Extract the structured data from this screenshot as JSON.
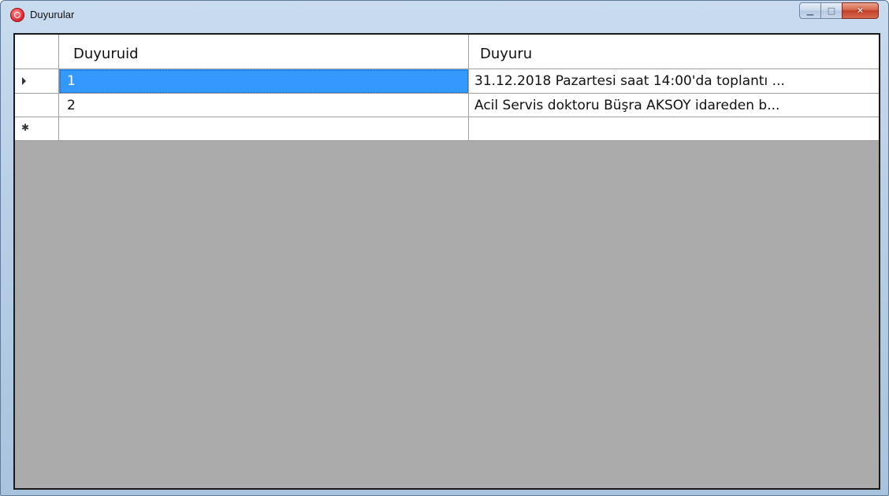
{
  "window": {
    "title": "Duyurular",
    "controls": [
      "minimize-icon",
      "maximize-icon",
      "close-icon"
    ]
  },
  "grid": {
    "columns": [
      "Duyuruid",
      "Duyuru"
    ],
    "rows": [
      {
        "Duyuruid": "1",
        "Duyuru": "31.12.2018 Pazartesi saat 14:00'da toplantı ...",
        "selected": true,
        "row_header": "current-row-arrow-icon"
      },
      {
        "Duyuruid": "2",
        "Duyuru": "Acil Servis doktoru Büşra AKSOY idareden b...",
        "selected": false,
        "row_header": ""
      }
    ],
    "new_row_marker": "new-row-star-icon",
    "colors": {
      "selection": "#3399ff",
      "empty_area": "#ababab"
    }
  }
}
